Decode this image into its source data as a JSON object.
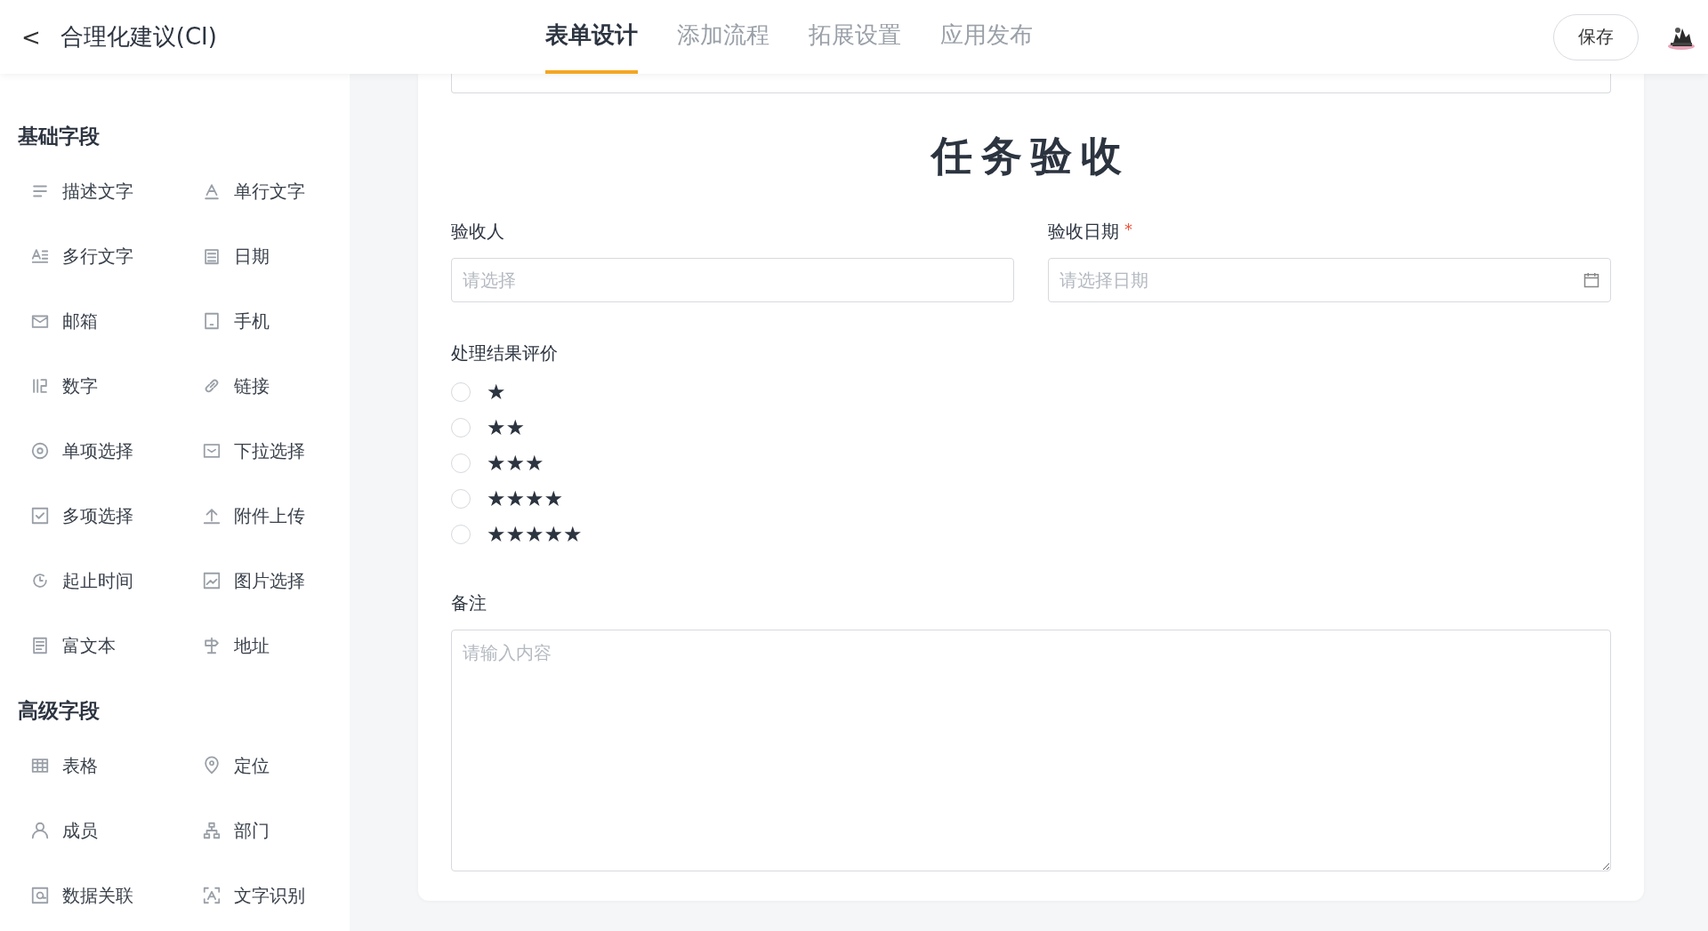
{
  "header": {
    "back": "<",
    "title": "合理化建议(CI)",
    "tabs": [
      {
        "label": "表单设计",
        "selected": true
      },
      {
        "label": "添加流程",
        "selected": false
      },
      {
        "label": "拓展设置",
        "selected": false
      },
      {
        "label": "应用发布",
        "selected": false
      }
    ],
    "save": "保存"
  },
  "sidebar": {
    "sections": [
      {
        "title": "基础字段",
        "items": [
          "描述文字",
          "单行文字",
          "多行文字",
          "日期",
          "邮箱",
          "手机",
          "数字",
          "链接",
          "单项选择",
          "下拉选择",
          "多项选择",
          "附件上传",
          "起止时间",
          "图片选择",
          "富文本",
          "地址"
        ]
      },
      {
        "title": "高级字段",
        "items": [
          "表格",
          "定位",
          "成员",
          "部门",
          "数据关联",
          "文字识别"
        ]
      }
    ]
  },
  "form": {
    "title": "任务验收",
    "inspector": {
      "label": "验收人",
      "placeholder": "请选择"
    },
    "date": {
      "label": "验收日期",
      "required_mark": "*",
      "placeholder": "请选择日期"
    },
    "rating": {
      "label": "处理结果评价",
      "options": [
        {
          "label": "★",
          "selected": false
        },
        {
          "label": "★★",
          "selected": false
        },
        {
          "label": "★★★",
          "selected": false
        },
        {
          "label": "★★★★",
          "selected": false
        },
        {
          "label": "★★★★★",
          "selected": false
        }
      ]
    },
    "remark": {
      "label": "备注",
      "placeholder": "请输入内容"
    }
  }
}
